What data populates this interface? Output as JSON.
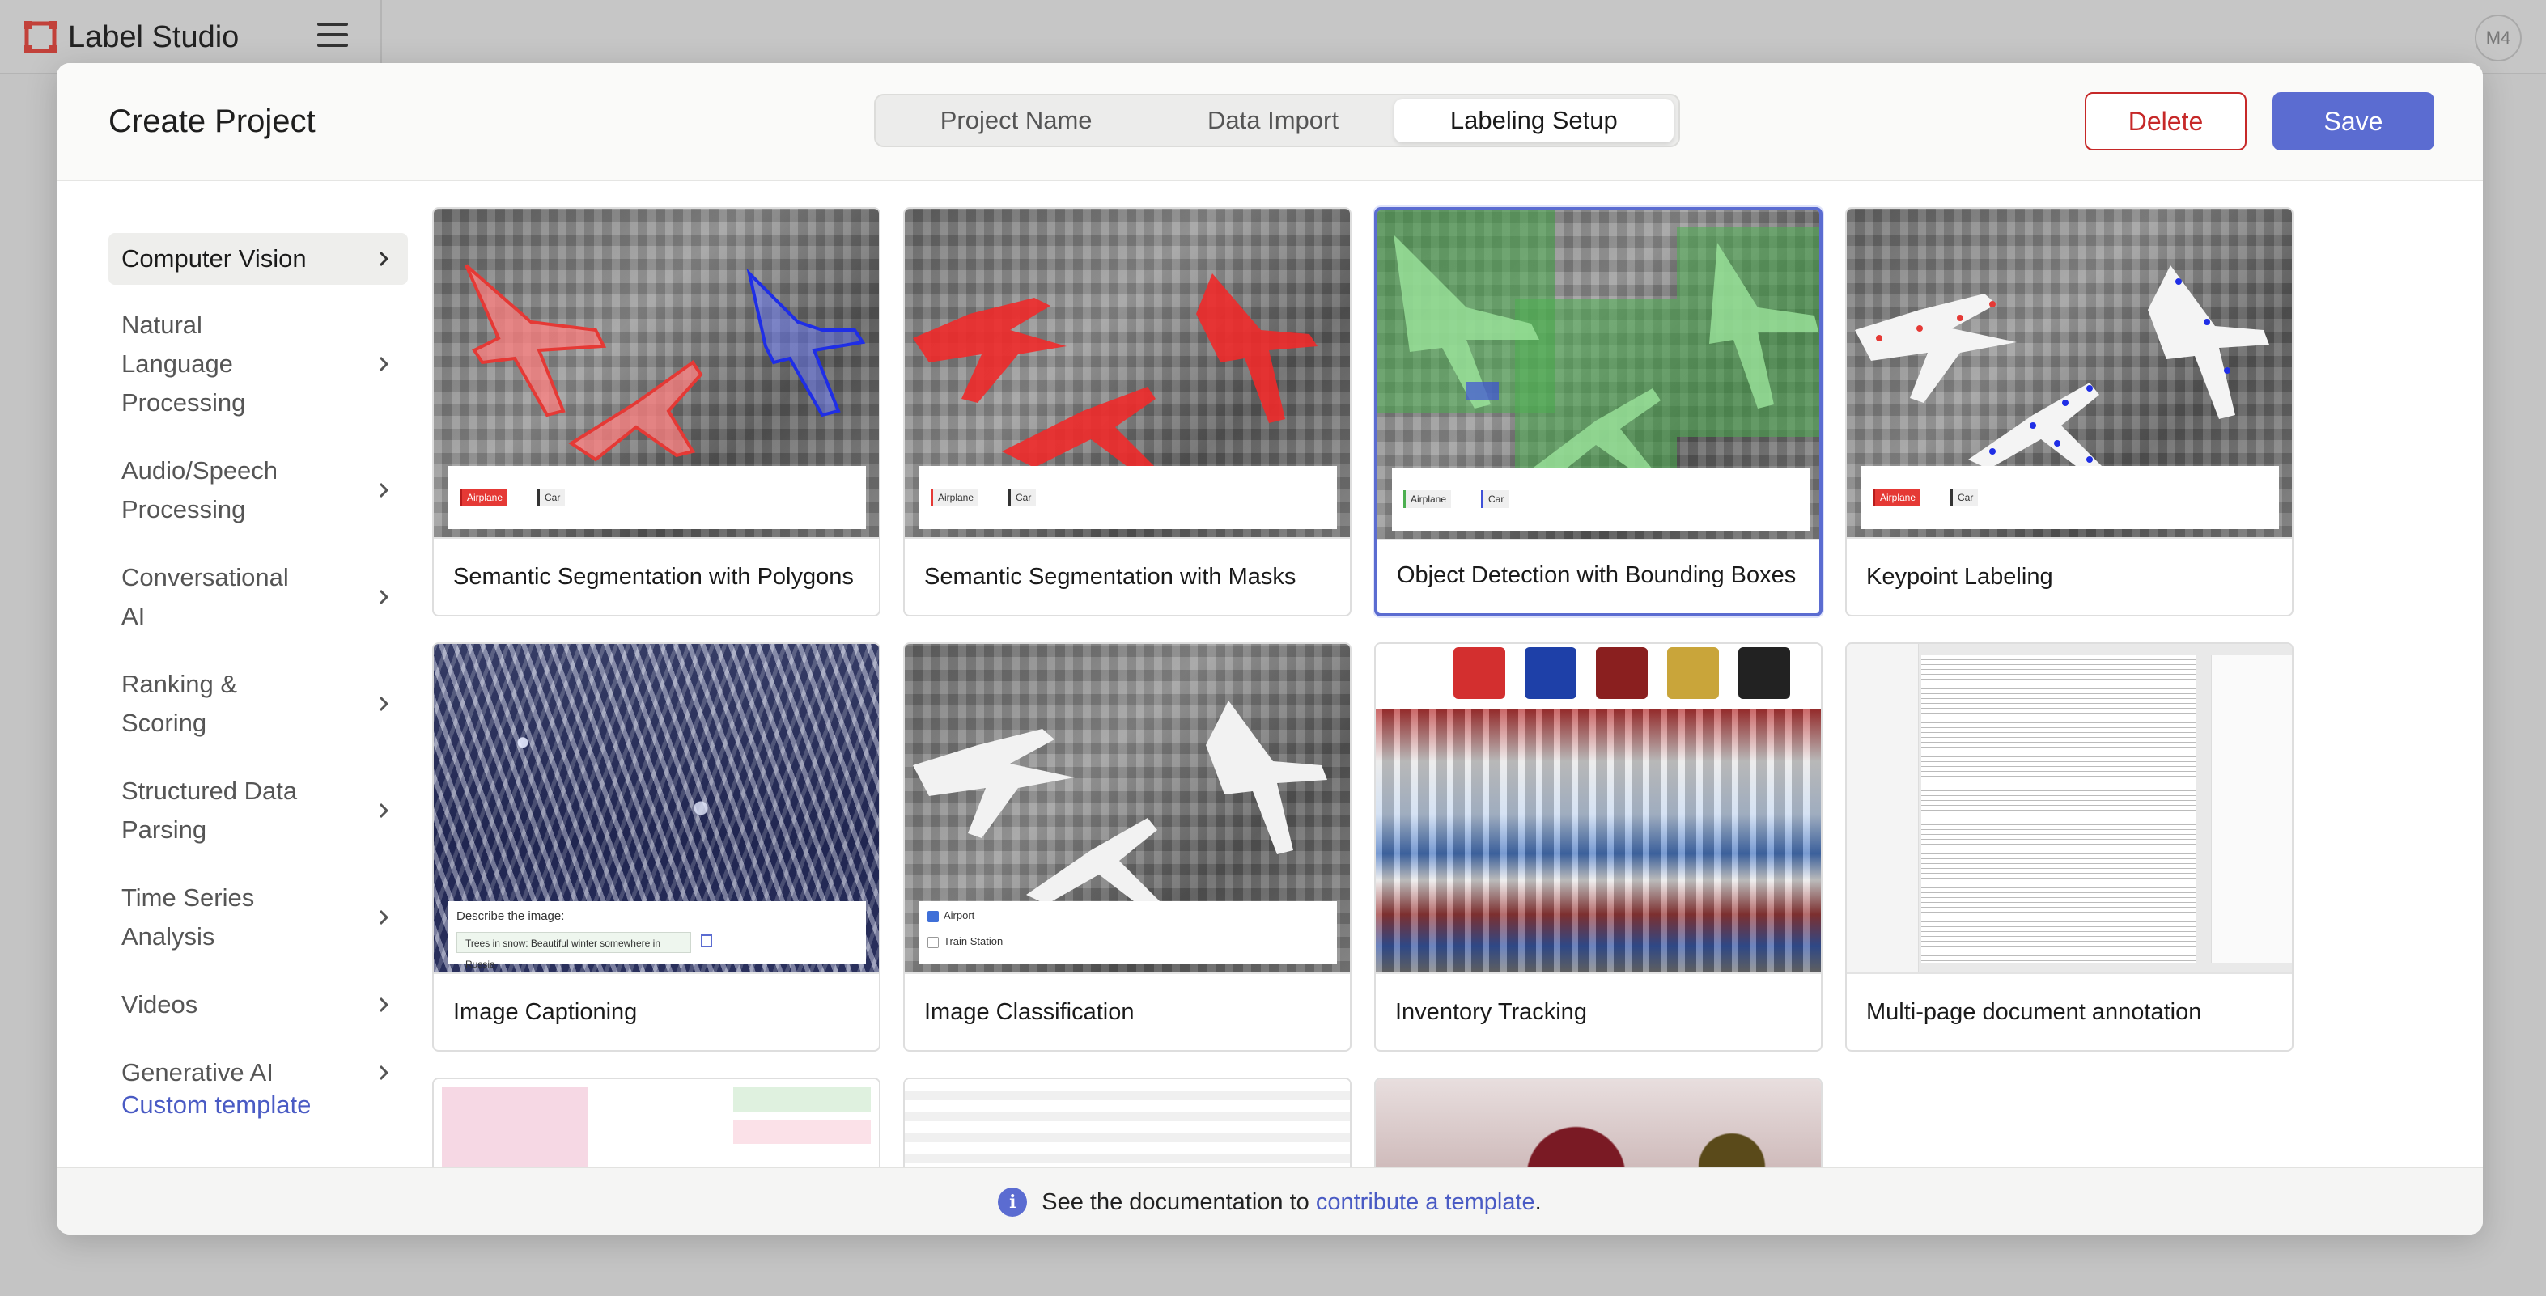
{
  "app": {
    "logo_text": "Label Studio",
    "avatar_initials": "M4"
  },
  "modal": {
    "title": "Create Project",
    "steps": [
      "Project Name",
      "Data Import",
      "Labeling Setup"
    ],
    "active_step": "Labeling Setup",
    "delete_label": "Delete",
    "save_label": "Save",
    "accent_color": "#5b6cd1",
    "danger_color": "#c62828"
  },
  "sidebar": {
    "categories": [
      {
        "label": "Computer Vision",
        "active": true
      },
      {
        "label": "Natural Language Processing",
        "active": false
      },
      {
        "label": "Audio/Speech Processing",
        "active": false
      },
      {
        "label": "Conversational AI",
        "active": false
      },
      {
        "label": "Ranking & Scoring",
        "active": false
      },
      {
        "label": "Structured Data Parsing",
        "active": false
      },
      {
        "label": "Time Series Analysis",
        "active": false
      },
      {
        "label": "Videos",
        "active": false
      },
      {
        "label": "Generative AI",
        "active": false
      }
    ],
    "custom_template_label": "Custom template"
  },
  "templates": [
    {
      "title": "Semantic Segmentation with Polygons",
      "selected": false
    },
    {
      "title": "Semantic Segmentation with Masks",
      "selected": false
    },
    {
      "title": "Object Detection with Bounding Boxes",
      "selected": true
    },
    {
      "title": "Keypoint Labeling",
      "selected": false
    },
    {
      "title": "Image Captioning",
      "selected": false
    },
    {
      "title": "Image Classification",
      "selected": false
    },
    {
      "title": "Inventory Tracking",
      "selected": false
    },
    {
      "title": "Multi-page document annotation",
      "selected": false
    }
  ],
  "thumb_labels": {
    "airplane": "Airplane",
    "car": "Car",
    "describe": "Describe the image:",
    "caption": "Trees in snow: Beautiful winter somewhere in Russia",
    "airport": "Airport",
    "train_station": "Train Station"
  },
  "footer": {
    "prefix": "See the documentation to ",
    "link": "contribute a template",
    "suffix": "."
  }
}
